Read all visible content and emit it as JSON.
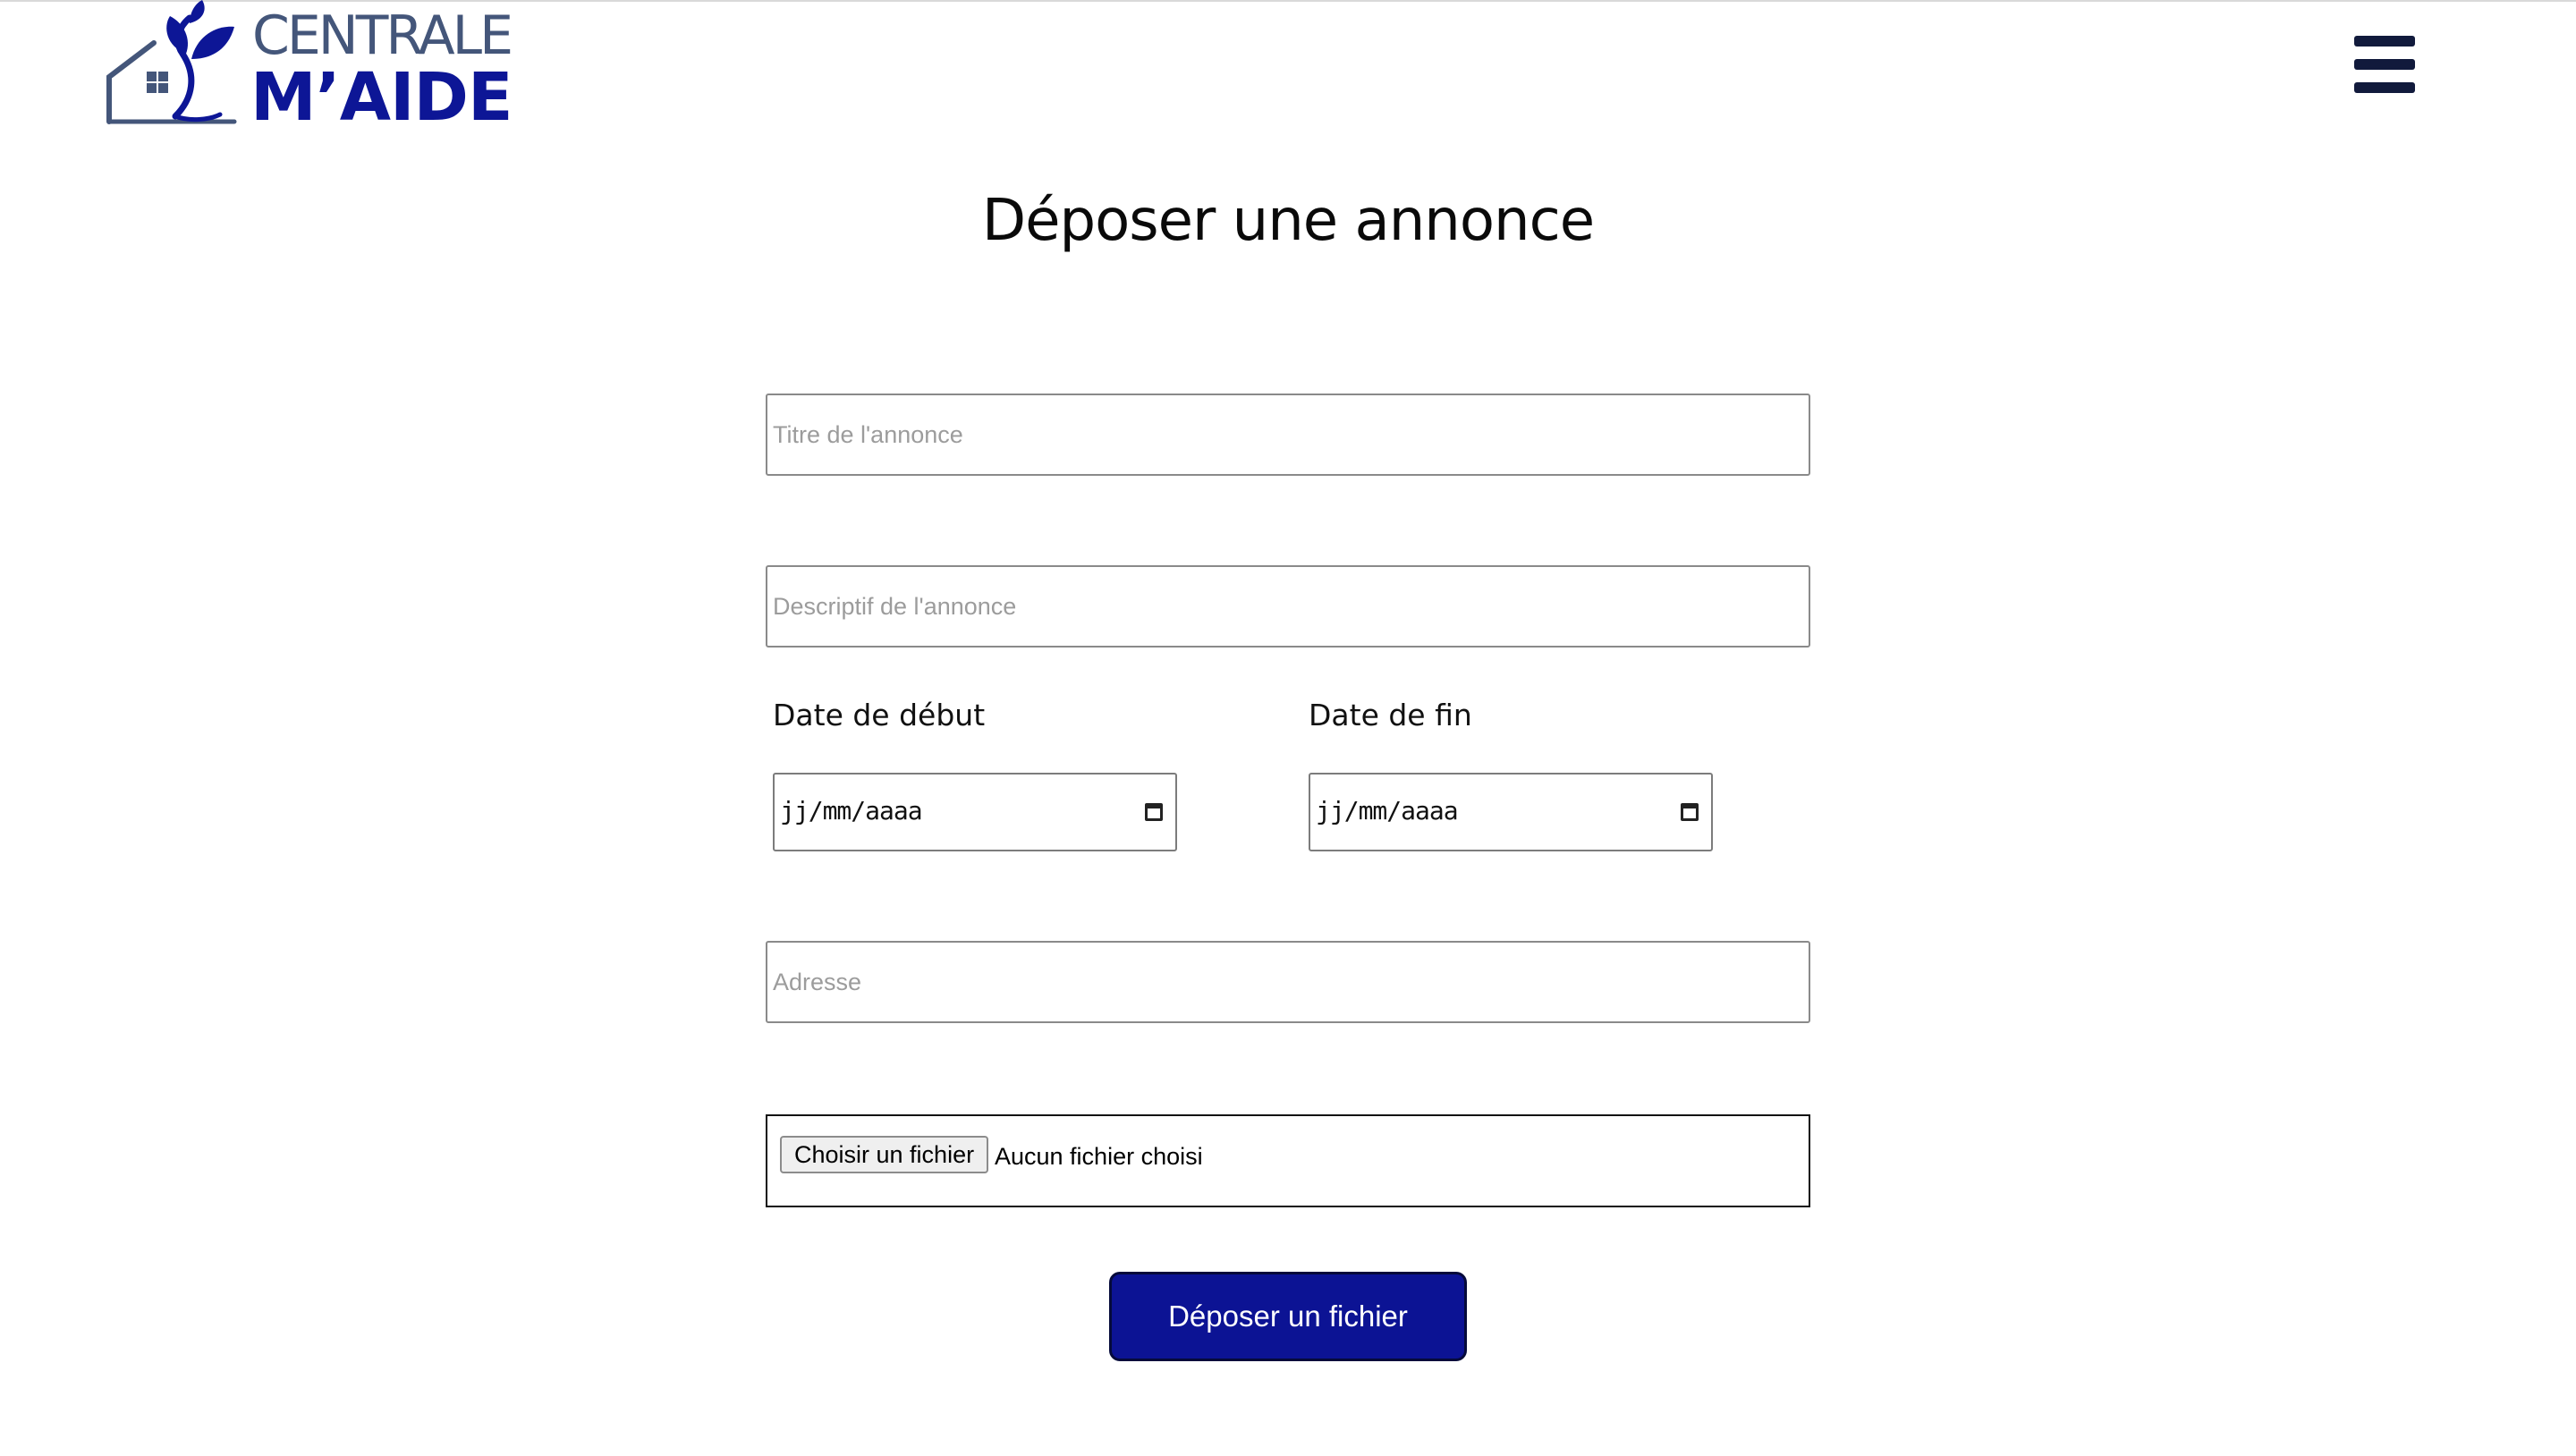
{
  "header": {
    "logo": {
      "line1": "CENTRALE",
      "line2": "M’AIDE"
    },
    "menu_icon": "hamburger-menu-icon"
  },
  "page": {
    "title": "Déposer une annonce"
  },
  "form": {
    "title_field": {
      "placeholder": "Titre de l'annonce",
      "value": ""
    },
    "description_field": {
      "placeholder": "Descriptif de l'annonce",
      "value": ""
    },
    "start_date": {
      "label": "Date de début",
      "placeholder": "jj/mm/aaaa"
    },
    "end_date": {
      "label": "Date de fin",
      "placeholder": "jj/mm/aaaa"
    },
    "address_field": {
      "placeholder": "Adresse",
      "value": ""
    },
    "file": {
      "button_label": "Choisir un fichier",
      "status": "Aucun fichier choisi"
    },
    "submit_label": "Déposer un fichier"
  },
  "colors": {
    "brand_dark_blue": "#0c1394",
    "logo_slate": "#44567a",
    "menu_icon": "#111a3c"
  }
}
